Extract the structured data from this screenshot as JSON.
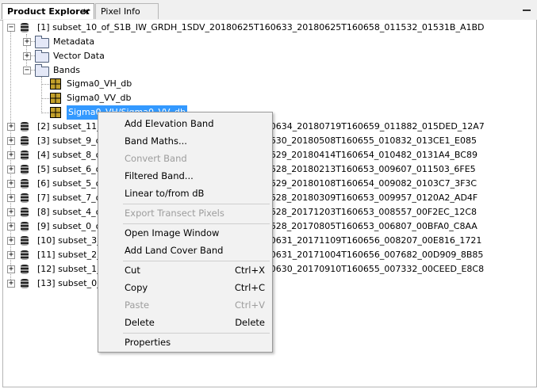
{
  "tabs": [
    {
      "label": "Product Explorer",
      "close": "✕"
    },
    {
      "label": "Pixel Info"
    }
  ],
  "tree": [
    {
      "label": "[1] subset_10_of_S1B_IW_GRDH_1SDV_20180625T160633_20180625T160658_011532_01531B_A1BD"
    },
    {
      "label": "Metadata"
    },
    {
      "label": "Vector Data"
    },
    {
      "label": "Bands"
    },
    {
      "label": "Sigma0_VH_db"
    },
    {
      "label": "Sigma0_VV_db"
    },
    {
      "label": "Sigma0_VH/Sigma0_VV_db"
    },
    {
      "label": "[2] subset_11_of_S1B_IW_GRDH_1SDV_20180719T160634_20180719T160659_011882_015DED_12A7"
    },
    {
      "label": "[3] subset_9_of_S1B_IW_GRDH_1SDV_20180508T160630_20180508T160655_010832_013CE1_E085"
    },
    {
      "label": "[4] subset_8_of_S1B_IW_GRDH_1SDV_20180414T160629_20180414T160654_010482_0131A4_BC89"
    },
    {
      "label": "[5] subset_6_of_S1B_IW_GRDH_1SDV_20180213T160628_20180213T160653_009607_011503_6FE5"
    },
    {
      "label": "[6] subset_5_of_S1B_IW_GRDH_1SDV_20180108T160629_20180108T160654_009082_0103C7_3F3C"
    },
    {
      "label": "[7] subset_7_of_S1B_IW_GRDH_1SDV_20180309T160628_20180309T160653_009957_0120A2_AD4F"
    },
    {
      "label": "[8] subset_4_of_S1B_IW_GRDH_1SDV_20171203T160628_20171203T160653_008557_00F2EC_12C8"
    },
    {
      "label": "[9] subset_0_of_S1B_IW_GRDH_1SDV_20170805T160628_20170805T160653_006807_00BFA0_C8AA"
    },
    {
      "label": "[10] subset_3_of_S1B_IW_GRDH_1SDV_20171109T160631_20171109T160656_008207_00E816_1721"
    },
    {
      "label": "[11] subset_2_of_S1B_IW_GRDH_1SDV_20171004T160631_20171004T160656_007682_00D909_8B85"
    },
    {
      "label": "[12] subset_1_of_S1B_IW_GRDH_1SDV_20170910T160630_20170910T160655_007332_00CEED_E8C8"
    },
    {
      "label": "[13] subset_0_of_S1B_IW_GRDH_1SDV"
    }
  ],
  "toggle_collapse": "−",
  "toggle_expand": "+",
  "menu": {
    "items": [
      {
        "label": "Add Elevation Band",
        "shortcut": ""
      },
      {
        "label": "Band Maths...",
        "shortcut": ""
      },
      {
        "label": "Convert Band",
        "shortcut": ""
      },
      {
        "label": "Filtered Band...",
        "shortcut": ""
      },
      {
        "label": "Linear to/from dB",
        "shortcut": ""
      },
      {
        "label": "Export Transect Pixels",
        "shortcut": ""
      },
      {
        "label": "Open Image Window",
        "shortcut": ""
      },
      {
        "label": "Add Land Cover Band",
        "shortcut": ""
      },
      {
        "label": "Cut",
        "shortcut": "Ctrl+X"
      },
      {
        "label": "Copy",
        "shortcut": "Ctrl+C"
      },
      {
        "label": "Paste",
        "shortcut": "Ctrl+V"
      },
      {
        "label": "Delete",
        "shortcut": "Delete"
      },
      {
        "label": "Properties",
        "shortcut": ""
      }
    ]
  },
  "colors": {
    "selection": "#3399ff",
    "disabled_text": "#9d9d9d",
    "menu_background": "#f2f2f2"
  }
}
